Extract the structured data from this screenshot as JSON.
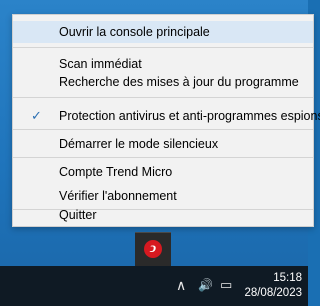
{
  "menu": {
    "items": [
      {
        "label": "Ouvrir la console principale",
        "checked": false,
        "highlight": true
      },
      {
        "label": "Scan immédiat",
        "checked": false,
        "highlight": false
      },
      {
        "label": "Recherche des mises à jour du programme",
        "checked": false,
        "highlight": false
      },
      {
        "label": "Protection antivirus et anti-programmes espions",
        "checked": true,
        "highlight": false
      },
      {
        "label": "Démarrer le mode silencieux",
        "checked": false,
        "highlight": false
      },
      {
        "label": "Compte Trend Micro",
        "checked": false,
        "highlight": false
      },
      {
        "label": "Vérifier l'abonnement",
        "checked": false,
        "highlight": false
      },
      {
        "label": "Quitter",
        "checked": false,
        "highlight": false
      }
    ],
    "check_glyph": "✓"
  },
  "tray": {
    "trend_icon_glyph": "ↄ",
    "chevron_glyph": "∧",
    "speaker_glyph": "🔊",
    "network_glyph": "▭",
    "clock_time": "15:18",
    "clock_date": "28/08/2023"
  },
  "colors": {
    "accent": "#2b6fb3",
    "menu_bg": "#f2f2f2",
    "highlight": "#d9e7f5",
    "trend_red": "#d71920"
  }
}
